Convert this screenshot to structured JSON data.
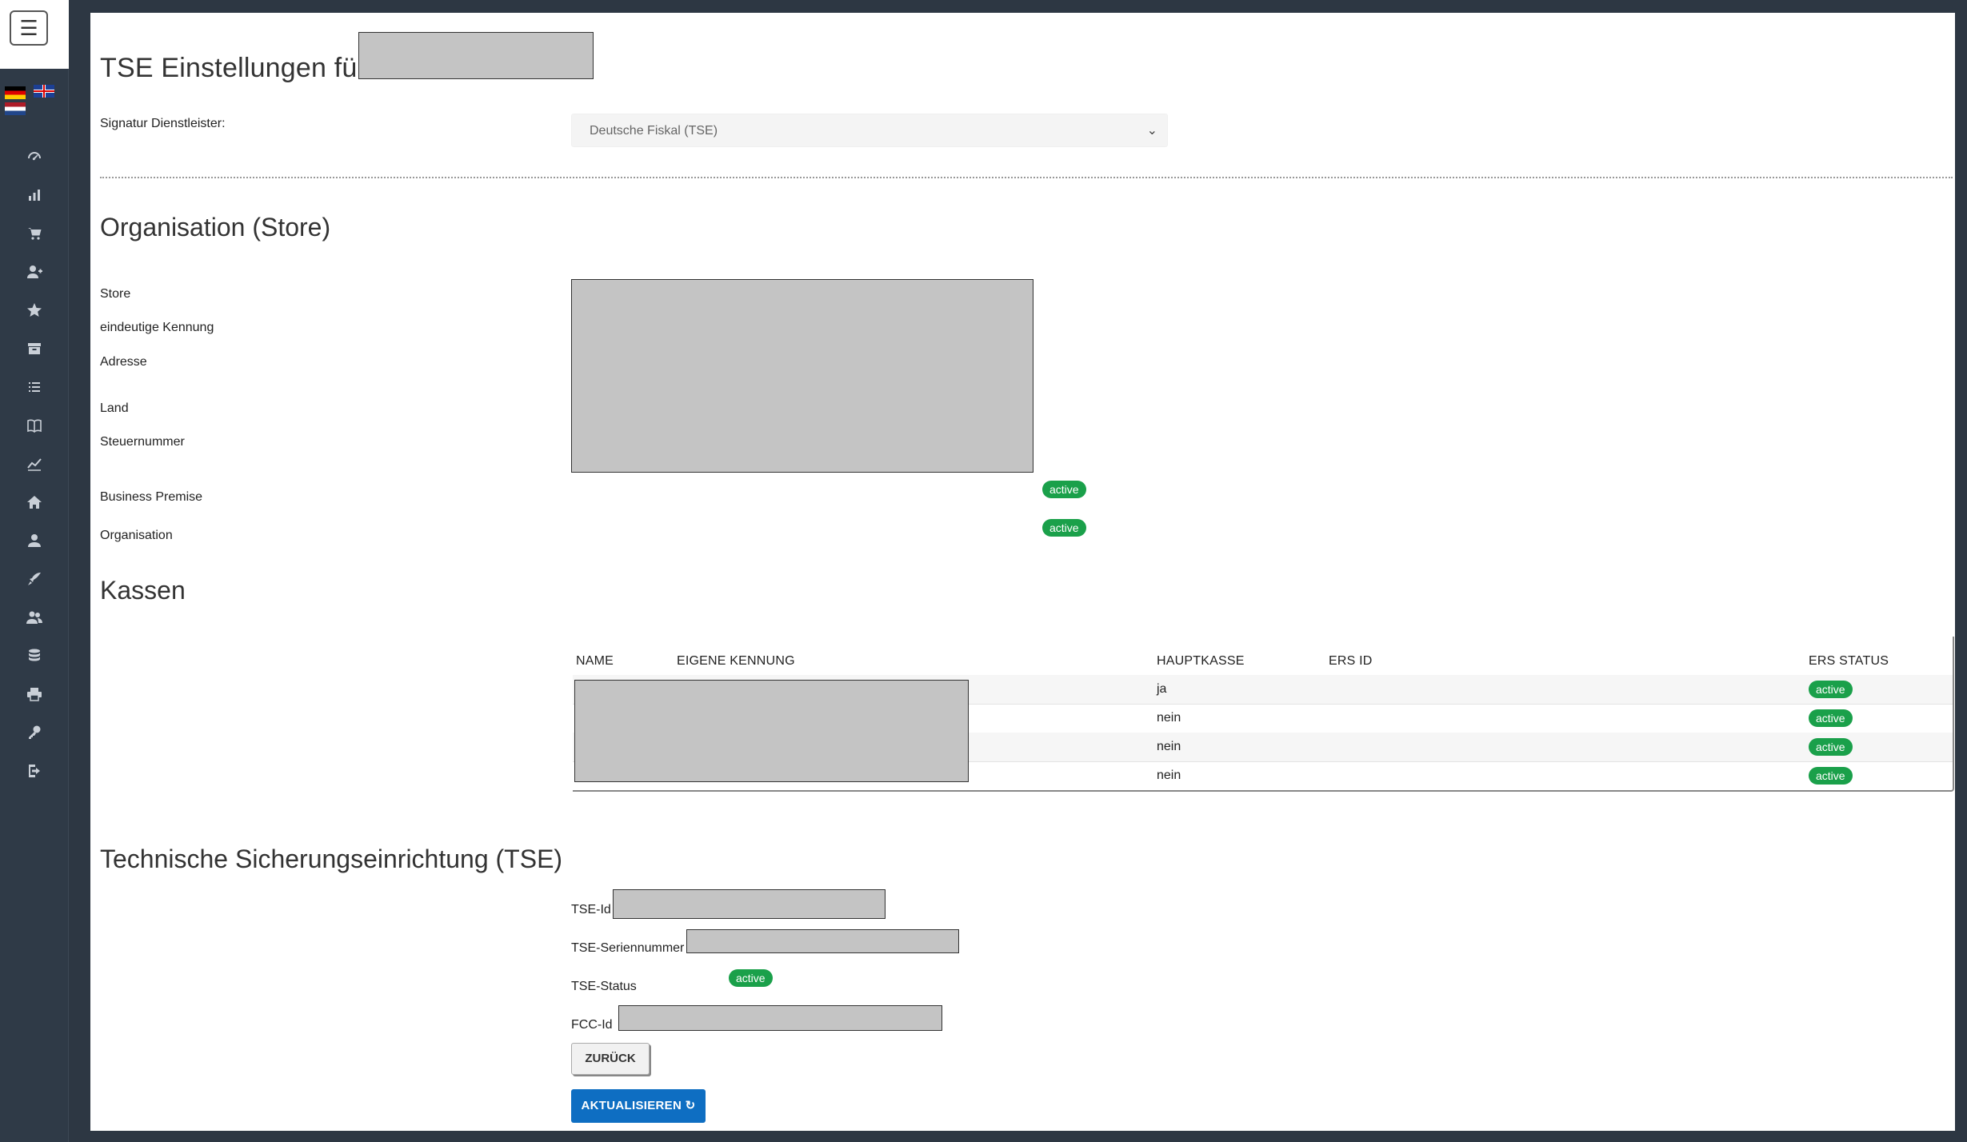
{
  "page": {
    "title": "TSE Einstellungen für:"
  },
  "signature": {
    "label": "Signatur Dienstleister:",
    "selected": "Deutsche Fiskal (TSE)"
  },
  "organisation": {
    "heading": "Organisation (Store)",
    "fields": [
      "Store",
      "eindeutige Kennung",
      "Adresse",
      "Land",
      "Steuernummer"
    ],
    "business_premise_label": "Business Premise",
    "business_premise_status": "active",
    "organisation_label": "Organisation",
    "organisation_status": "active"
  },
  "kassen": {
    "heading": "Kassen",
    "columns": [
      "NAME",
      "EIGENE KENNUNG",
      "HAUPTKASSE",
      "ERS ID",
      "ERS STATUS"
    ],
    "rows": [
      {
        "hauptkasse": "ja",
        "status": "active"
      },
      {
        "hauptkasse": "nein",
        "status": "active"
      },
      {
        "hauptkasse": "nein",
        "status": "active"
      },
      {
        "hauptkasse": "nein",
        "status": "active"
      }
    ]
  },
  "tse": {
    "heading": "Technische Sicherungseinrichtung (TSE)",
    "id_label": "TSE-Id",
    "serial_label": "TSE-Seriennummer",
    "status_label": "TSE-Status",
    "status": "active",
    "fcc_label": "FCC-Id"
  },
  "buttons": {
    "back": "ZURÜCK",
    "update": "AKTUALISIEREN"
  },
  "icons": {
    "sidebar": [
      "menu-icon",
      "dashboard-icon",
      "bar-chart-icon",
      "cart-icon",
      "user-plus-icon",
      "star-icon",
      "archive-icon",
      "list-icon",
      "book-icon",
      "line-chart-icon",
      "home-icon",
      "user-icon",
      "rocket-icon",
      "users-icon",
      "database-icon",
      "printer-icon",
      "key-icon",
      "logout-icon"
    ]
  },
  "colors": {
    "badge": "#1aa04a",
    "primary_button": "#0e6ec2",
    "sidebar": "#2f3a47"
  }
}
